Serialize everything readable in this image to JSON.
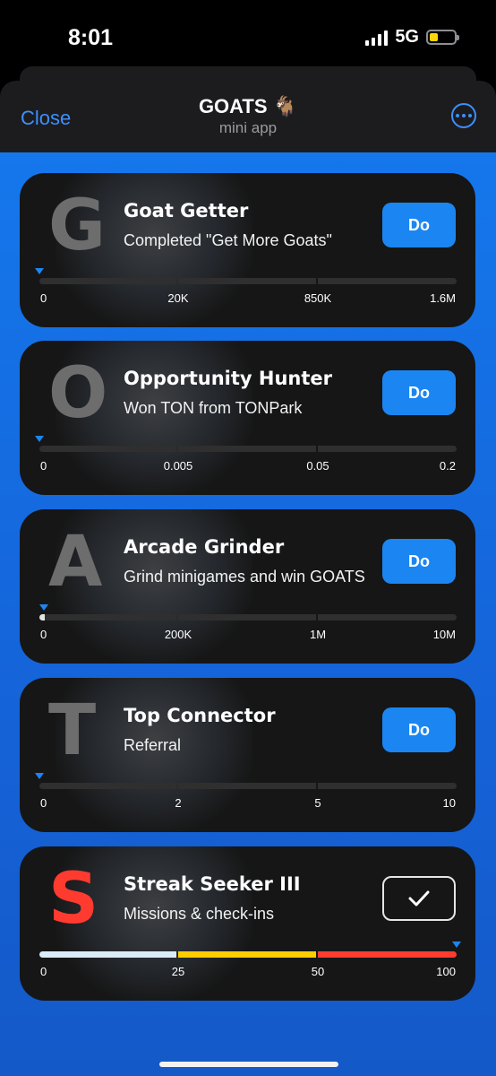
{
  "status_bar": {
    "time": "8:01",
    "network": "5G",
    "battery_level": 0.35,
    "battery_color": "#ffd60a"
  },
  "header": {
    "close_label": "Close",
    "title": "GOATS 🐐",
    "subtitle": "mini app",
    "accent": "#3f8efc"
  },
  "accent": {
    "button": "#1b86f2",
    "background": "#1577ec"
  },
  "cards": [
    {
      "letter": "G",
      "title": "Goat Getter",
      "subtitle": "Completed \"Get More Goats\"",
      "action": "Do",
      "ticks": [
        "0",
        "20K",
        "850K",
        "1.6M"
      ],
      "progress": 0
    },
    {
      "letter": "O",
      "title": "Opportunity Hunter",
      "subtitle": "Won TON from TONPark",
      "action": "Do",
      "ticks": [
        "0",
        "0.005",
        "0.05",
        "0.2"
      ],
      "progress": 0
    },
    {
      "letter": "A",
      "title": "Arcade Grinder",
      "subtitle": "Grind minigames and win GOATS",
      "action": "Do",
      "ticks": [
        "0",
        "200K",
        "1M",
        "10M"
      ],
      "progress": 0.01
    },
    {
      "letter": "T",
      "title": "Top Connector",
      "subtitle": "Referral",
      "action": "Do",
      "ticks": [
        "0",
        "2",
        "5",
        "10"
      ],
      "progress": 0
    },
    {
      "letter": "S",
      "title": "Streak Seeker III",
      "subtitle": "Missions & check-ins",
      "action": "completed",
      "ticks": [
        "0",
        "25",
        "50",
        "100"
      ],
      "progress": 1,
      "segment_colors": [
        "#d9ecf7",
        "#ffcc00",
        "#ff3b30"
      ]
    }
  ]
}
